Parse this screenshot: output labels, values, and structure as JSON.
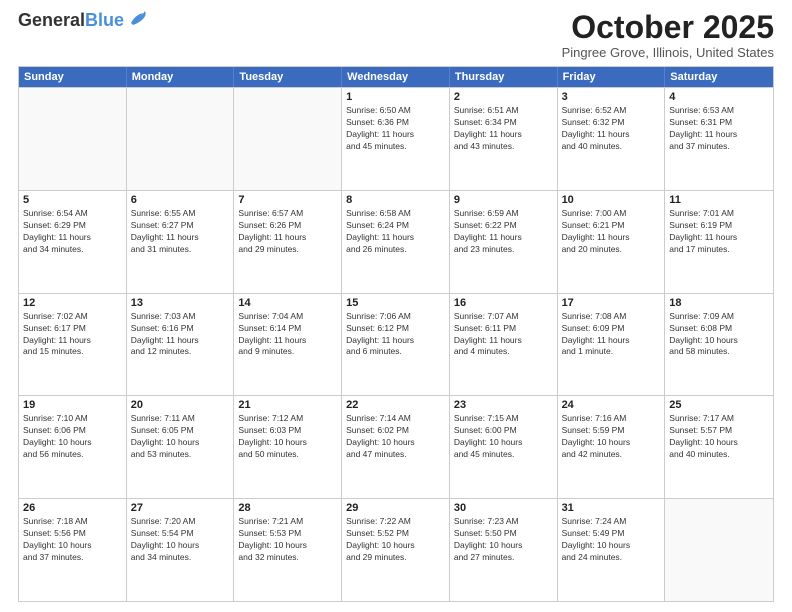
{
  "header": {
    "logo_general": "General",
    "logo_blue": "Blue",
    "month_title": "October 2025",
    "location": "Pingree Grove, Illinois, United States"
  },
  "days_of_week": [
    "Sunday",
    "Monday",
    "Tuesday",
    "Wednesday",
    "Thursday",
    "Friday",
    "Saturday"
  ],
  "weeks": [
    [
      {
        "day": "",
        "info": ""
      },
      {
        "day": "",
        "info": ""
      },
      {
        "day": "",
        "info": ""
      },
      {
        "day": "1",
        "info": "Sunrise: 6:50 AM\nSunset: 6:36 PM\nDaylight: 11 hours\nand 45 minutes."
      },
      {
        "day": "2",
        "info": "Sunrise: 6:51 AM\nSunset: 6:34 PM\nDaylight: 11 hours\nand 43 minutes."
      },
      {
        "day": "3",
        "info": "Sunrise: 6:52 AM\nSunset: 6:32 PM\nDaylight: 11 hours\nand 40 minutes."
      },
      {
        "day": "4",
        "info": "Sunrise: 6:53 AM\nSunset: 6:31 PM\nDaylight: 11 hours\nand 37 minutes."
      }
    ],
    [
      {
        "day": "5",
        "info": "Sunrise: 6:54 AM\nSunset: 6:29 PM\nDaylight: 11 hours\nand 34 minutes."
      },
      {
        "day": "6",
        "info": "Sunrise: 6:55 AM\nSunset: 6:27 PM\nDaylight: 11 hours\nand 31 minutes."
      },
      {
        "day": "7",
        "info": "Sunrise: 6:57 AM\nSunset: 6:26 PM\nDaylight: 11 hours\nand 29 minutes."
      },
      {
        "day": "8",
        "info": "Sunrise: 6:58 AM\nSunset: 6:24 PM\nDaylight: 11 hours\nand 26 minutes."
      },
      {
        "day": "9",
        "info": "Sunrise: 6:59 AM\nSunset: 6:22 PM\nDaylight: 11 hours\nand 23 minutes."
      },
      {
        "day": "10",
        "info": "Sunrise: 7:00 AM\nSunset: 6:21 PM\nDaylight: 11 hours\nand 20 minutes."
      },
      {
        "day": "11",
        "info": "Sunrise: 7:01 AM\nSunset: 6:19 PM\nDaylight: 11 hours\nand 17 minutes."
      }
    ],
    [
      {
        "day": "12",
        "info": "Sunrise: 7:02 AM\nSunset: 6:17 PM\nDaylight: 11 hours\nand 15 minutes."
      },
      {
        "day": "13",
        "info": "Sunrise: 7:03 AM\nSunset: 6:16 PM\nDaylight: 11 hours\nand 12 minutes."
      },
      {
        "day": "14",
        "info": "Sunrise: 7:04 AM\nSunset: 6:14 PM\nDaylight: 11 hours\nand 9 minutes."
      },
      {
        "day": "15",
        "info": "Sunrise: 7:06 AM\nSunset: 6:12 PM\nDaylight: 11 hours\nand 6 minutes."
      },
      {
        "day": "16",
        "info": "Sunrise: 7:07 AM\nSunset: 6:11 PM\nDaylight: 11 hours\nand 4 minutes."
      },
      {
        "day": "17",
        "info": "Sunrise: 7:08 AM\nSunset: 6:09 PM\nDaylight: 11 hours\nand 1 minute."
      },
      {
        "day": "18",
        "info": "Sunrise: 7:09 AM\nSunset: 6:08 PM\nDaylight: 10 hours\nand 58 minutes."
      }
    ],
    [
      {
        "day": "19",
        "info": "Sunrise: 7:10 AM\nSunset: 6:06 PM\nDaylight: 10 hours\nand 56 minutes."
      },
      {
        "day": "20",
        "info": "Sunrise: 7:11 AM\nSunset: 6:05 PM\nDaylight: 10 hours\nand 53 minutes."
      },
      {
        "day": "21",
        "info": "Sunrise: 7:12 AM\nSunset: 6:03 PM\nDaylight: 10 hours\nand 50 minutes."
      },
      {
        "day": "22",
        "info": "Sunrise: 7:14 AM\nSunset: 6:02 PM\nDaylight: 10 hours\nand 47 minutes."
      },
      {
        "day": "23",
        "info": "Sunrise: 7:15 AM\nSunset: 6:00 PM\nDaylight: 10 hours\nand 45 minutes."
      },
      {
        "day": "24",
        "info": "Sunrise: 7:16 AM\nSunset: 5:59 PM\nDaylight: 10 hours\nand 42 minutes."
      },
      {
        "day": "25",
        "info": "Sunrise: 7:17 AM\nSunset: 5:57 PM\nDaylight: 10 hours\nand 40 minutes."
      }
    ],
    [
      {
        "day": "26",
        "info": "Sunrise: 7:18 AM\nSunset: 5:56 PM\nDaylight: 10 hours\nand 37 minutes."
      },
      {
        "day": "27",
        "info": "Sunrise: 7:20 AM\nSunset: 5:54 PM\nDaylight: 10 hours\nand 34 minutes."
      },
      {
        "day": "28",
        "info": "Sunrise: 7:21 AM\nSunset: 5:53 PM\nDaylight: 10 hours\nand 32 minutes."
      },
      {
        "day": "29",
        "info": "Sunrise: 7:22 AM\nSunset: 5:52 PM\nDaylight: 10 hours\nand 29 minutes."
      },
      {
        "day": "30",
        "info": "Sunrise: 7:23 AM\nSunset: 5:50 PM\nDaylight: 10 hours\nand 27 minutes."
      },
      {
        "day": "31",
        "info": "Sunrise: 7:24 AM\nSunset: 5:49 PM\nDaylight: 10 hours\nand 24 minutes."
      },
      {
        "day": "",
        "info": ""
      }
    ]
  ]
}
